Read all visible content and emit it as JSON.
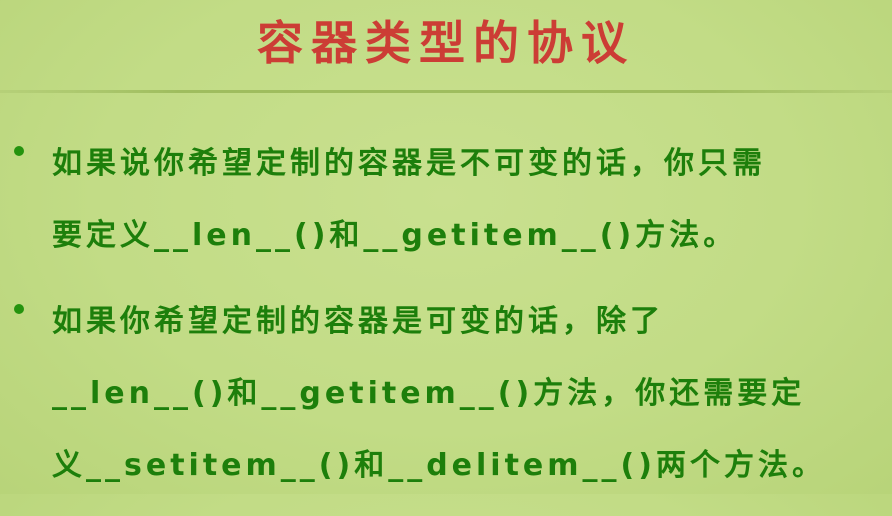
{
  "slide": {
    "title": "容器类型的协议",
    "bullets": [
      {
        "lines": [
          "如果说你希望定制的容器是不可变的话，你只需",
          "要定义__len__()和__getitem__()方法。"
        ]
      },
      {
        "lines": [
          "如果你希望定制的容器是可变的话，除了",
          "__len__()和__getitem__()方法，你还需要定",
          "义__setitem__()和__delitem__()两个方法。"
        ]
      }
    ]
  },
  "colors": {
    "background": "#c2dc86",
    "title": "#cc3d35",
    "text": "#1d7f0b",
    "bullet": "#24930e"
  }
}
